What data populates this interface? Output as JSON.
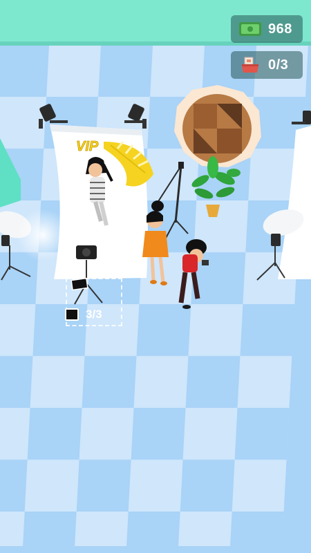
{
  "hud": {
    "money": {
      "icon": "cash-icon",
      "value": "968"
    },
    "photos": {
      "icon": "photo-tray-icon",
      "value": "0/3"
    }
  },
  "camera_station": {
    "counter": "3/3"
  },
  "scene": {
    "sign_text": "VIP",
    "colors": {
      "floor_light": "#cfe6fb",
      "floor_dark": "#a9d3f7",
      "top_wall": "#7ee8cf",
      "backdrop": "#ffffff",
      "vip_gold": "#f5d320",
      "dress_orange": "#f08a1c",
      "shirt_red": "#d8262a"
    }
  }
}
